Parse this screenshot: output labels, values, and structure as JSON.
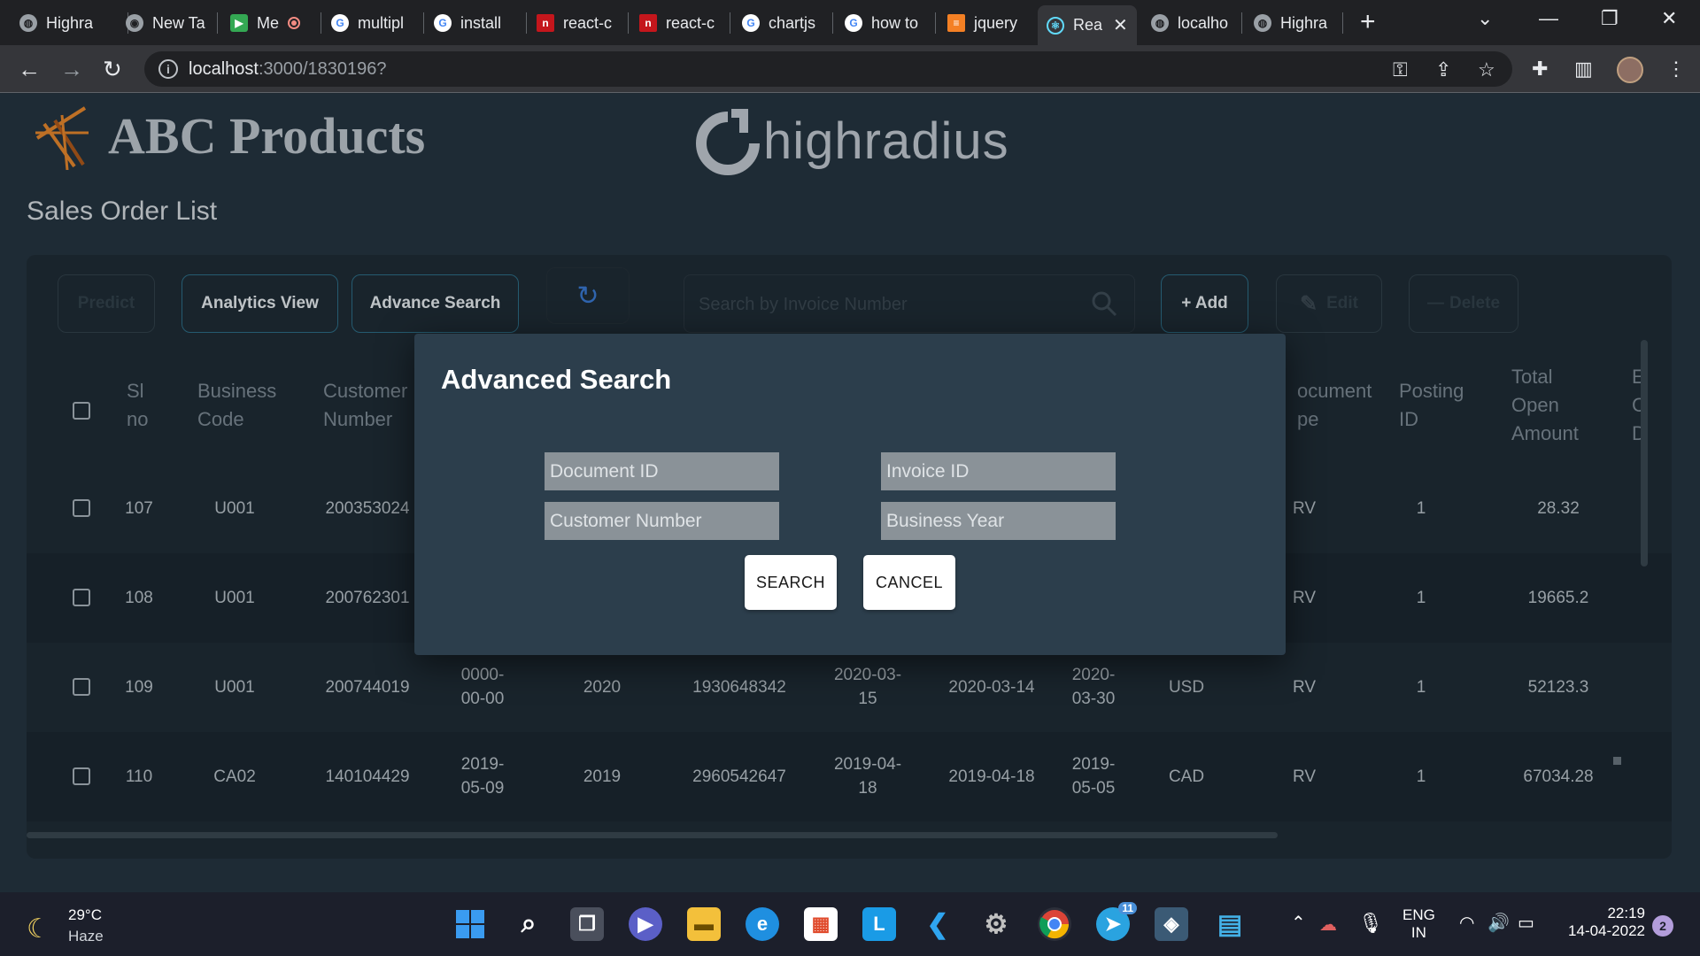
{
  "browser": {
    "tabs": [
      {
        "label": "Highra",
        "icon": "globe"
      },
      {
        "label": "New Ta",
        "icon": "chrome"
      },
      {
        "label": "Me",
        "icon": "meet"
      },
      {
        "label": "multipl",
        "icon": "google"
      },
      {
        "label": "install",
        "icon": "google"
      },
      {
        "label": "react-c",
        "icon": "npm"
      },
      {
        "label": "react-c",
        "icon": "npm"
      },
      {
        "label": "chartjs",
        "icon": "google"
      },
      {
        "label": "how to",
        "icon": "google"
      },
      {
        "label": "jquery",
        "icon": "stackoverflow"
      },
      {
        "label": "Rea",
        "icon": "react"
      },
      {
        "label": "localho",
        "icon": "globe"
      },
      {
        "label": "Highra",
        "icon": "globe"
      }
    ],
    "active_tab_index": 10,
    "url_host": "localhost",
    "url_path": ":3000/1830196?"
  },
  "app": {
    "brand": "ABC Products",
    "partner_logo": "highradius",
    "page_title": "Sales Order List",
    "toolbar": {
      "predict": "Predict",
      "analytics": "Analytics View",
      "advance_search": "Advance Search",
      "refresh_icon": "refresh-icon",
      "search_placeholder": "Search by Invoice Number",
      "add": "+ Add",
      "edit": "Edit",
      "delete": "Delete"
    },
    "table": {
      "headers_left": [
        {
          "l1": "Sl",
          "l2": "no"
        },
        {
          "l1": "Business",
          "l2": "Code"
        },
        {
          "l1": "Customer",
          "l2": "Number"
        }
      ],
      "headers_right": [
        {
          "l1": "ocument",
          "l2": "pe"
        },
        {
          "l1": "Posting",
          "l2": "ID"
        },
        {
          "l1": "Total",
          "l2": "Open",
          "l3": "Amount"
        },
        {
          "l1": "E",
          "l2": "C",
          "l3": "D"
        }
      ],
      "rows": [
        {
          "sl": "107",
          "code": "U001",
          "cust": "200353024",
          "d1a": "",
          "d1b": "",
          "year": "",
          "doc": "",
          "d2a": "",
          "d2b": "",
          "d3": "",
          "d4a": "",
          "d4b": "",
          "cur": "",
          "type": "RV",
          "post": "1",
          "amt": "28.32"
        },
        {
          "sl": "108",
          "code": "U001",
          "cust": "200762301",
          "d1a": "",
          "d1b": "",
          "year": "",
          "doc": "",
          "d2a": "",
          "d2b": "",
          "d3": "",
          "d4a": "",
          "d4b": "",
          "cur": "",
          "type": "RV",
          "post": "1",
          "amt": "19665.2"
        },
        {
          "sl": "109",
          "code": "U001",
          "cust": "200744019",
          "d1a": "0000-",
          "d1b": "00-00",
          "year": "2020",
          "doc": "1930648342",
          "d2a": "2020-03-",
          "d2b": "15",
          "d3": "2020-03-14",
          "d4a": "2020-",
          "d4b": "03-30",
          "cur": "USD",
          "type": "RV",
          "post": "1",
          "amt": "52123.3"
        },
        {
          "sl": "110",
          "code": "CA02",
          "cust": "140104429",
          "d1a": "2019-",
          "d1b": "05-09",
          "year": "2019",
          "doc": "2960542647",
          "d2a": "2019-04-",
          "d2b": "18",
          "d3": "2019-04-18",
          "d4a": "2019-",
          "d4b": "05-05",
          "cur": "CAD",
          "type": "RV",
          "post": "1",
          "amt": "67034.28"
        }
      ]
    }
  },
  "modal": {
    "title": "Advanced Search",
    "fields": {
      "document_id": "Document ID",
      "invoice_id": "Invoice ID",
      "customer_number": "Customer Number",
      "business_year": "Business Year"
    },
    "search_label": "SEARCH",
    "cancel_label": "CANCEL"
  },
  "taskbar": {
    "temperature": "29°C",
    "weather": "Haze",
    "telegram_badge": "11",
    "lang_line1": "ENG",
    "lang_line2": "IN",
    "time": "22:19",
    "date": "14-04-2022",
    "notifications": "2"
  },
  "colors": {
    "page_bg": "#253541",
    "panel_bg": "#1f2c36",
    "modal_bg": "#2c3e4c",
    "accent_border": "#2e6f89",
    "field_bg": "#8a9298"
  }
}
